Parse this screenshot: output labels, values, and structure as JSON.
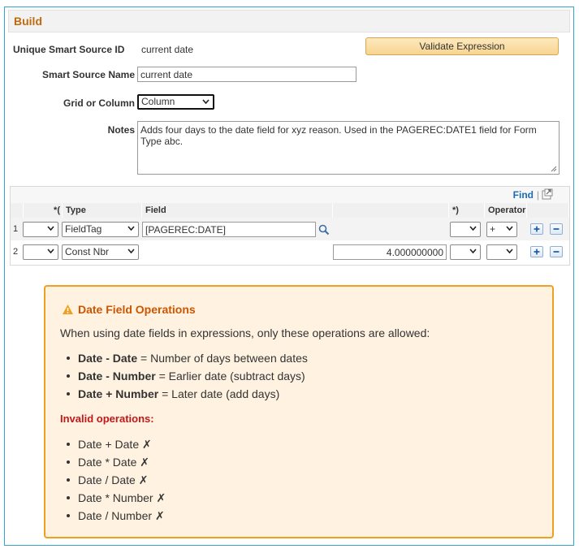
{
  "section": {
    "title": "Build"
  },
  "form": {
    "unique_id_label": "Unique Smart Source ID",
    "unique_id_value": "current date",
    "name_label": "Smart Source Name",
    "name_value": "current date",
    "grid_label": "Grid or Column",
    "grid_value": "Column",
    "notes_label": "Notes",
    "notes_value": "Adds four days to the date field for xyz reason.  Used in the PAGEREC:DATE1 field for Form Type abc.",
    "validate_label": "Validate Expression"
  },
  "grid": {
    "find_label": "Find",
    "separator": "|",
    "columns": {
      "open_paren": "*(",
      "type": "Type",
      "field": "Field",
      "close_paren": "*)",
      "operator": "Operator"
    },
    "rows": [
      {
        "num": "1",
        "type": "FieldTag",
        "field": "[PAGEREC:DATE]",
        "constant": "",
        "operator": "+"
      },
      {
        "num": "2",
        "type": "Const Nbr",
        "field": "",
        "constant": "4.000000000",
        "operator": ""
      }
    ]
  },
  "warning": {
    "title": "Date Field Operations",
    "intro": "When using date fields in expressions, only these operations are allowed:",
    "allowed": [
      {
        "op": "Date - Date",
        "desc": " = Number of days between dates"
      },
      {
        "op": "Date - Number",
        "desc": " = Earlier date (subtract days)"
      },
      {
        "op": "Date + Number",
        "desc": " = Later date (add days)"
      }
    ],
    "invalid_title": "Invalid operations:",
    "invalid": [
      {
        "op": "Date + Date",
        "mark": "✗"
      },
      {
        "op": "Date * Date",
        "mark": "✗"
      },
      {
        "op": "Date / Date",
        "mark": "✗"
      },
      {
        "op": "Date * Number",
        "mark": "✗"
      },
      {
        "op": "Date / Number",
        "mark": "✗"
      }
    ]
  },
  "colors": {
    "accent_orange": "#c06a0c",
    "frame_blue": "#33a6cc",
    "warning_border": "#f0a020",
    "warning_bg": "#fff2e1",
    "invalid_red": "#c01818",
    "link_blue": "#1c6bb5"
  },
  "icons": {
    "lookup": "magnifier-icon",
    "add_row": "plus-icon",
    "delete_row": "minus-icon",
    "expand_grid": "expand-window-icon",
    "warning": "warning-triangle-icon"
  }
}
